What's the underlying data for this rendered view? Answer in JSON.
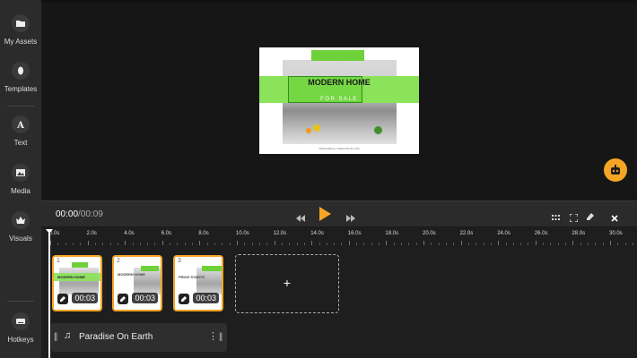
{
  "sidebar": {
    "items": [
      {
        "label": "My Assets",
        "icon": "folder-icon"
      },
      {
        "label": "Templates",
        "icon": "templates-icon"
      },
      {
        "label": "Text",
        "icon": "text-icon"
      },
      {
        "label": "Media",
        "icon": "image-icon"
      },
      {
        "label": "Visuals",
        "icon": "crown-icon"
      }
    ],
    "hotkeys": {
      "label": "Hotkeys",
      "icon": "keyboard-icon"
    }
  },
  "preview": {
    "title": "MODERN HOME",
    "subtitle": "FOR SALE",
    "url": "WWW.REALLYGREATSITE.COM"
  },
  "controls": {
    "current_time": "00:00",
    "separator": "/",
    "total_time": "00:09"
  },
  "ruler": {
    "labels": [
      "0.0s",
      "2.0s",
      "4.0s",
      "6.0s",
      "8.0s",
      "10.0s",
      "12.0s",
      "14.0s",
      "16.0s",
      "18.0s",
      "20.0s",
      "22.0s",
      "24.0s",
      "26.0s",
      "28.0s",
      "30.0s"
    ]
  },
  "clips": [
    {
      "number": "1",
      "duration": "00:03",
      "text": "MODERN HOME"
    },
    {
      "number": "2",
      "duration": "00:03",
      "text": "MODERN HOME"
    },
    {
      "number": "3",
      "duration": "00:03",
      "text": "PRICE STARTS"
    }
  ],
  "add_clip": {
    "label": "+"
  },
  "audio": {
    "title": "Paradise On Earth"
  },
  "colors": {
    "accent": "#f5a524",
    "brand_green": "#6fd13a",
    "background": "#1e1e1e",
    "panel": "#2b2b2b"
  }
}
